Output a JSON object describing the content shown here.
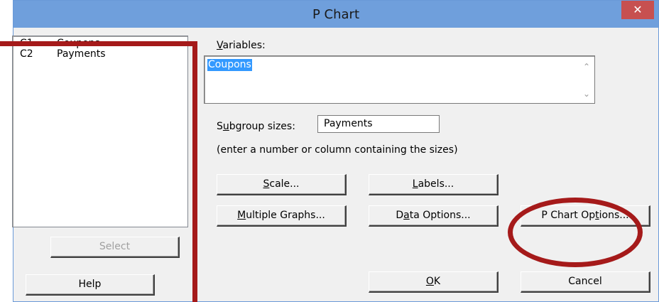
{
  "window": {
    "title": "P Chart",
    "close_glyph": "✕"
  },
  "variables_list": [
    {
      "column": "C1",
      "name": "Coupons"
    },
    {
      "column": "C2",
      "name": "Payments"
    }
  ],
  "select_label": "Select",
  "help_label": "Help",
  "variables_field": {
    "label_mnemonic": "V",
    "label_rest": "ariables:",
    "value": "Coupons"
  },
  "subgroup": {
    "label_pre": "S",
    "label_mnemonic": "u",
    "label_rest": "bgroup sizes:",
    "value": "Payments",
    "hint": "(enter a number or column containing the sizes)"
  },
  "buttons": {
    "scale": {
      "mnemonic": "S",
      "rest": "cale..."
    },
    "labels": {
      "mnemonic": "L",
      "rest": "abels..."
    },
    "multiple_graphs": {
      "mnemonic": "M",
      "rest": "ultiple Graphs..."
    },
    "data_options": {
      "pre": "D",
      "mnemonic": "a",
      "rest": "ta Options..."
    },
    "p_chart_options": {
      "pre": "P Chart Op",
      "mnemonic": "t",
      "rest": "ions..."
    },
    "ok": {
      "mnemonic": "O",
      "rest": "K"
    },
    "cancel": {
      "label": "Cancel"
    }
  },
  "annotation_colors": {
    "highlight": "#a51a1a",
    "selection": "#3399ff",
    "titlebar": "#6f9fdc",
    "close": "#c75050"
  }
}
